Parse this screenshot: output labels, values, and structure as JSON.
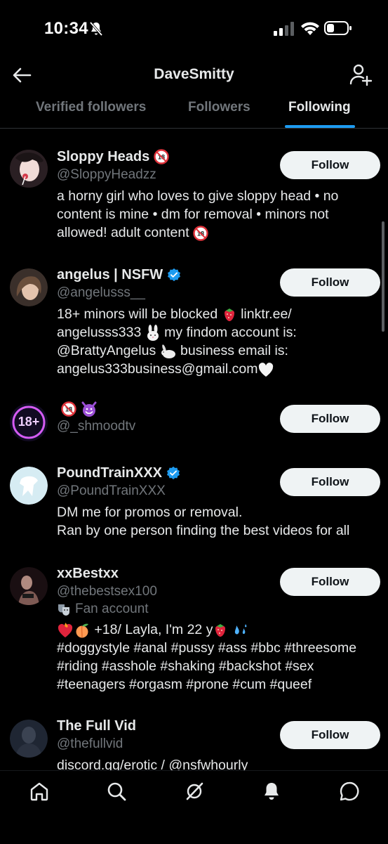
{
  "status_bar": {
    "time": "10:34"
  },
  "header": {
    "title": "DaveSmitty"
  },
  "tabs": [
    {
      "label": "Verified followers",
      "active": false
    },
    {
      "label": "Followers",
      "active": false
    },
    {
      "label": "Following",
      "active": true
    }
  ],
  "follow_label": "Follow",
  "users": [
    {
      "name": "Sloppy Heads",
      "handle": "@SloppyHeadzz",
      "verified": false,
      "bio": "a horny girl who loves to give sloppy head • no content is mine • dm for removal • minors not allowed! adult content"
    },
    {
      "name": "angelus | NSFW",
      "handle": "@angelusss__",
      "verified": true,
      "bio_parts": [
        "18+ minors will be blocked ",
        " linktr.ee/\nangelusss333 ",
        " my findom account is:\n@BrattyAngelus ",
        " business email is:\nangelus333business@gmail.com"
      ]
    },
    {
      "name": "",
      "handle": "@_shmoodtv",
      "verified": false,
      "avatar_text": "18+"
    },
    {
      "name": "PoundTrainXXX",
      "handle": "@PoundTrainXXX",
      "verified": true,
      "bio": "DM me for promos or removal.\nRan by one person finding the best videos for all"
    },
    {
      "name": "xxBestxx",
      "handle": "@thebestsex100",
      "verified": false,
      "meta": "Fan account",
      "bio_line1": " +18/ Layla, I'm 22 y",
      "bio_rest": "#doggystyle #anal #pussy #ass #bbc #threesome\n#riding #asshole #shaking #backshot #sex\n#teenagers #orgasm #prone #cum #queef"
    },
    {
      "name": "The Full Vid",
      "handle": "@thefullvid",
      "verified": false,
      "bio": "discord.gg/erotic / @nsfwhourly"
    }
  ],
  "colors": {
    "accent": "#1d9bf0",
    "background": "#000000",
    "button_bg": "#eff3f4",
    "muted": "#71767b"
  },
  "icons": [
    "back-arrow-icon",
    "add-user-icon",
    "home-icon",
    "search-icon",
    "grok-icon",
    "notifications-icon",
    "messages-icon"
  ]
}
